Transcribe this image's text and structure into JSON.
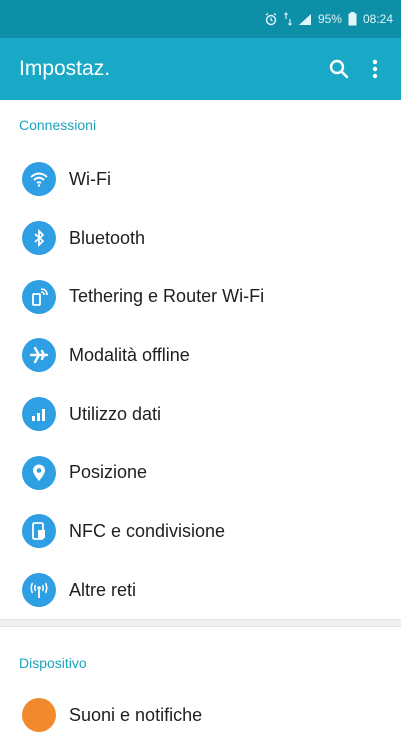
{
  "status_bar": {
    "battery_percent": "95%",
    "time": "08:24"
  },
  "app_bar": {
    "title": "Impostaz.",
    "search_icon": "search-icon",
    "more_icon": "more-vert-icon"
  },
  "sections": {
    "connessioni": "Connessioni",
    "dispositivo": "Dispositivo"
  },
  "items": [
    {
      "label": "Wi-Fi",
      "icon": "wifi-icon"
    },
    {
      "label": "Bluetooth",
      "icon": "bluetooth-icon"
    },
    {
      "label": "Tethering e Router Wi-Fi",
      "icon": "tethering-icon"
    },
    {
      "label": "Modalità offline",
      "icon": "airplane-icon"
    },
    {
      "label": "Utilizzo dati",
      "icon": "data-usage-icon"
    },
    {
      "label": "Posizione",
      "icon": "location-icon"
    },
    {
      "label": "NFC e condivisione",
      "icon": "nfc-icon"
    },
    {
      "label": "Altre reti",
      "icon": "network-icon"
    }
  ],
  "partial_item": {
    "label": "Suoni e notifiche",
    "icon": "sound-icon"
  },
  "colors": {
    "status_bar": "#0d8fa8",
    "app_bar": "#19a9c6",
    "accent": "#1aa3bf",
    "icon_circle": "#2f9fe3",
    "icon_circle_device": "#f08a2c"
  }
}
